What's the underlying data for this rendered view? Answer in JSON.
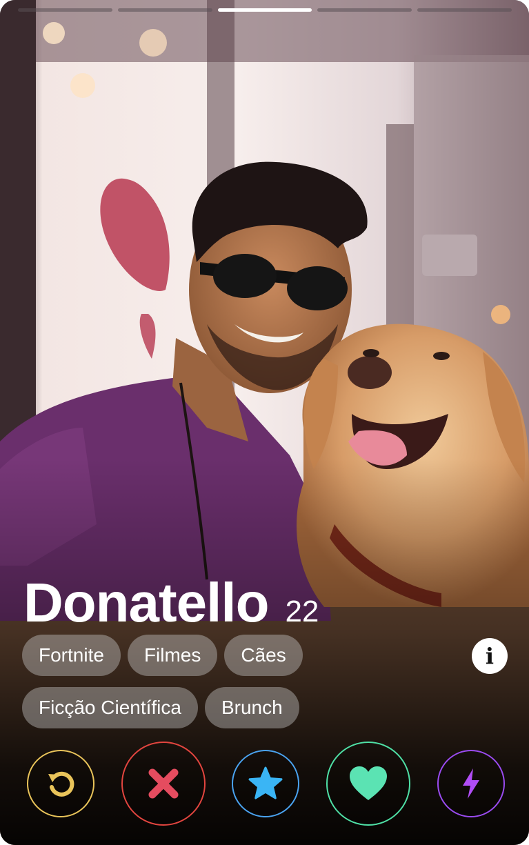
{
  "progress": {
    "total": 5,
    "current": 3
  },
  "profile": {
    "name": "Donatello",
    "age": "22",
    "interests": [
      "Fortnite",
      "Filmes",
      "Cães",
      "Ficção Científica",
      "Brunch"
    ]
  },
  "info_button": {
    "icon": "info-icon",
    "glyph": "i"
  },
  "actions": [
    {
      "id": "rewind",
      "icon": "rewind-icon",
      "color": "#e9c45a"
    },
    {
      "id": "nope",
      "icon": "close-icon",
      "color": "#e2453f"
    },
    {
      "id": "super-like",
      "icon": "star-icon",
      "color": "#4aa3f0"
    },
    {
      "id": "like",
      "icon": "heart-icon",
      "color": "#4fe0a6"
    },
    {
      "id": "boost",
      "icon": "lightning-icon",
      "color": "#9a4bf0"
    }
  ]
}
